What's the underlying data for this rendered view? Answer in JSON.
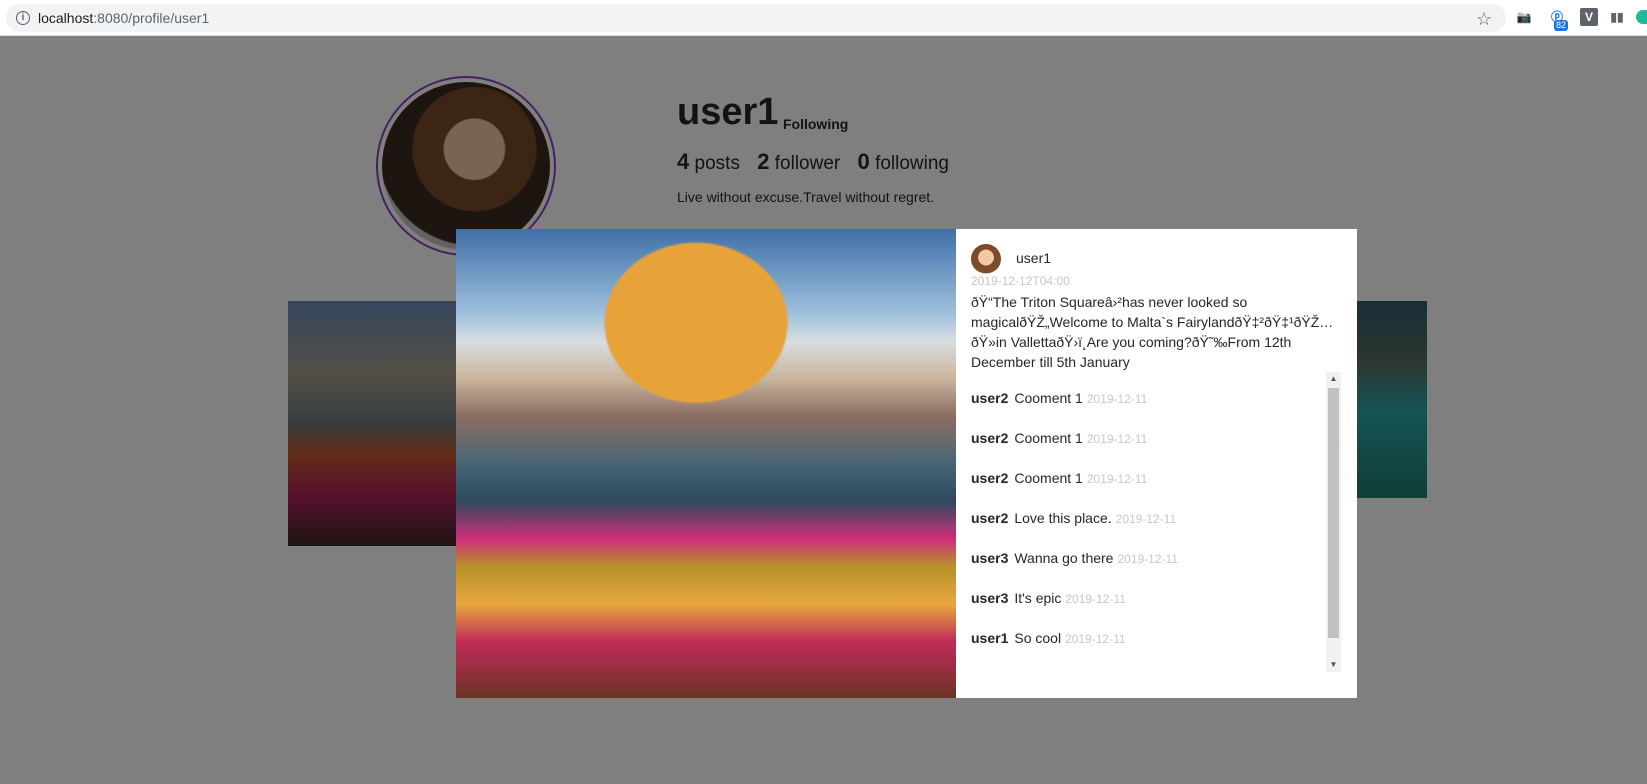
{
  "browser": {
    "url_host": "localhost",
    "url_path": ":8080/profile/user1",
    "extension_badge": "82"
  },
  "profile": {
    "username": "user1",
    "follow_status": "Following",
    "posts_count": "4",
    "posts_label": "posts",
    "followers_count": "2",
    "followers_label": "follower",
    "following_count": "0",
    "following_label": "following",
    "bio": "Live without excuse.Travel without regret."
  },
  "modal": {
    "author": "user1",
    "date": "2019-12-12T04:00",
    "caption": "ðŸ“The Triton Squareâ›²has never looked so magicalðŸŽ„Welcome to Malta`s FairylandðŸ‡²ðŸ‡¹ðŸŽ…ðŸ»in VallettaðŸ›ï¸Are you coming?ðŸ˜‰From 12th December till 5th January",
    "comments": [
      {
        "user": "user2",
        "text": "Cooment 1",
        "date": "2019-12-11"
      },
      {
        "user": "user2",
        "text": "Cooment 1",
        "date": "2019-12-11"
      },
      {
        "user": "user2",
        "text": "Cooment 1",
        "date": "2019-12-11"
      },
      {
        "user": "user2",
        "text": "Love this place.",
        "date": "2019-12-11"
      },
      {
        "user": "user3",
        "text": "Wanna go there",
        "date": "2019-12-11"
      },
      {
        "user": "user3",
        "text": "It's epic",
        "date": "2019-12-11"
      },
      {
        "user": "user1",
        "text": "So cool",
        "date": "2019-12-11"
      }
    ]
  }
}
